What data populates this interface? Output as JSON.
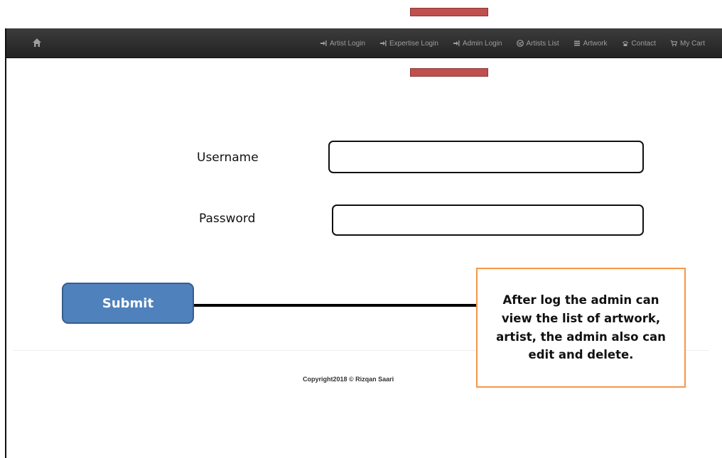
{
  "navbar": {
    "home_icon": "home-icon",
    "links": [
      {
        "label": "Artist Login",
        "icon": "login-icon"
      },
      {
        "label": "Expertise Login",
        "icon": "login-icon"
      },
      {
        "label": "Admin Login",
        "icon": "login-icon"
      },
      {
        "label": "Artists List",
        "icon": "globe-icon"
      },
      {
        "label": "Artwork",
        "icon": "list-icon"
      },
      {
        "label": "Contact",
        "icon": "phone-icon"
      },
      {
        "label": "My Cart",
        "icon": "cart-icon"
      }
    ],
    "background_color": "#222222",
    "text_color": "#9d9d9d"
  },
  "form": {
    "username_label": "Username",
    "username_value": "",
    "password_label": "Password",
    "password_value": "",
    "submit_label": "Submit"
  },
  "callout": {
    "text": "After log the admin can view the list of artwork, artist, the admin also can edit and delete.",
    "border_color": "#f79646"
  },
  "footer": {
    "copyright": "Copyright2018 © Rizqan Saari"
  },
  "colors": {
    "submit_fill": "#4f81bd",
    "marker_red": "#c0504d"
  }
}
